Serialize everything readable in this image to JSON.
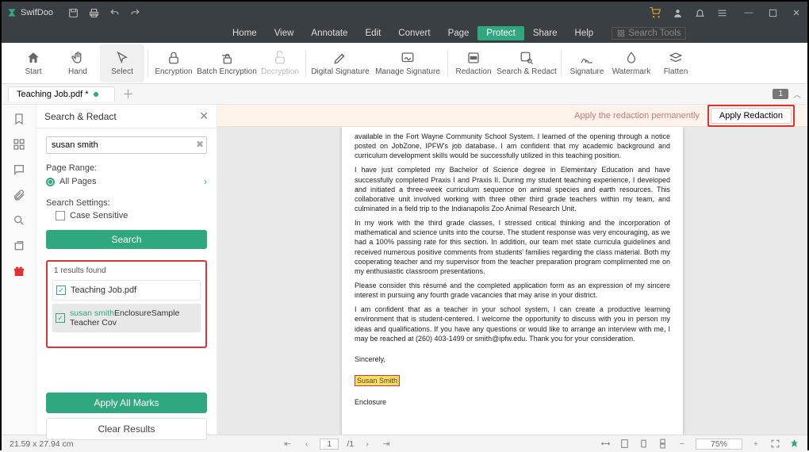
{
  "app": {
    "name": "SwifDoo"
  },
  "titlebar_icons": [
    "save-icon",
    "print-icon",
    "undo-icon",
    "redo-icon"
  ],
  "menubar": {
    "items": [
      "Home",
      "View",
      "Annotate",
      "Edit",
      "Convert",
      "Page",
      "Protect",
      "Share",
      "Help"
    ],
    "active_index": 6,
    "search_tools": "Search Tools"
  },
  "ribbon": {
    "buttons": [
      {
        "label": "Start",
        "icon": "home-icon"
      },
      {
        "label": "Hand",
        "icon": "hand-icon"
      },
      {
        "label": "Select",
        "icon": "cursor-icon",
        "selected": true
      },
      {
        "label": "Encryption",
        "icon": "lock-icon"
      },
      {
        "label": "Batch Encryption",
        "icon": "batch-lock-icon",
        "wide": true
      },
      {
        "label": "Decryption",
        "icon": "unlock-icon",
        "disabled": true
      },
      {
        "label": "Digital Signature",
        "icon": "pen-sign-icon",
        "wide": true
      },
      {
        "label": "Manage Signature",
        "icon": "manage-sign-icon",
        "wide": true
      },
      {
        "label": "Redaction",
        "icon": "redaction-icon"
      },
      {
        "label": "Search & Redact",
        "icon": "search-redact-icon",
        "wide": true
      },
      {
        "label": "Signature",
        "icon": "signature-icon"
      },
      {
        "label": "Watermark",
        "icon": "watermark-icon"
      },
      {
        "label": "Flatten",
        "icon": "flatten-icon"
      }
    ],
    "separators_after": [
      2,
      5,
      7,
      9
    ]
  },
  "tabs": {
    "document_name": "Teaching Job.pdf *",
    "page_badge": "1"
  },
  "sidebar": {
    "title": "Search & Redact",
    "search_value": "susan smith",
    "page_range_label": "Page Range:",
    "page_range_option": "All Pages",
    "settings_label": "Search Settings:",
    "case_sensitive": "Case Sensitive",
    "search_btn": "Search",
    "results_found": "1 results found",
    "result_file": "Teaching Job.pdf",
    "match_highlight": "susan smith",
    "match_context": "EnclosureSample Teacher Cov",
    "apply_marks": "Apply All Marks",
    "clear_results": "Clear Results"
  },
  "apply_bar": {
    "message": "Apply the redaction permanently",
    "button": "Apply Redaction"
  },
  "document": {
    "p1": "available in the Fort Wayne Community School System. I learned of the opening through a notice posted on JobZone, IPFW's job database. I am confident that my academic background and curriculum development skills would be successfully utilized in this teaching position.",
    "p2": "I have just completed my Bachelor of Science degree in Elementary Education and have successfully completed Praxis I and Praxis II. During my student teaching experience, I developed and initiated a three-week curriculum sequence on animal species and earth resources. This collaborative unit involved working with three other third grade teachers within my team, and culminated in a field trip to the Indianapolis Zoo Animal Research Unit.",
    "p3": "In my work with the third grade classes, I stressed critical thinking and the incorporation of mathematical and science units into the course.  The student response was very encouraging, as we had a 100% passing rate for this section.  In addition, our team met state curricula guidelines and received numerous positive comments from students' families regarding the class material. Both my cooperating teacher and my supervisor from the teacher preparation program complimented me on my enthusiastic classroom presentations.",
    "p4": "Please consider this résumé and the completed application form as an expression of my sincere interest in pursuing any fourth grade vacancies that may arise in your district.",
    "p5": "I am confident that as a teacher in your school system, I can create a productive learning environment that is student-centered. I welcome the opportunity to discuss with you in person my ideas and qualifications. If you have any questions or would like to arrange an interview with me, I may be reached at (260) 403-1499 or smith@ipfw.edu. Thank you for your consideration.",
    "closing": "Sincerely,",
    "signature": "Susan Smith",
    "enclosure": "Enclosure"
  },
  "statusbar": {
    "dimensions": "21.59 x 27.94 cm",
    "current_page": "1",
    "total_pages": "/1",
    "zoom": "75%"
  }
}
